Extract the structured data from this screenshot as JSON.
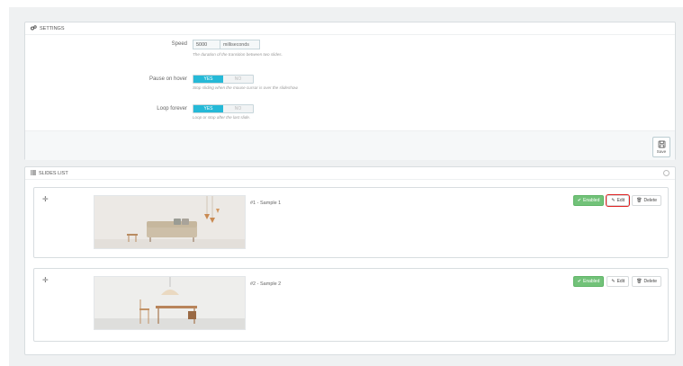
{
  "settings": {
    "heading": "SETTINGS",
    "speed": {
      "label": "Speed",
      "value": "5000",
      "unit": "milliseconds",
      "help": "The duration of the transition between two slides."
    },
    "pause_on_hover": {
      "label": "Pause on hover",
      "yes": "YES",
      "no": "NO",
      "selected": "YES",
      "help": "Stop sliding when the mouse cursor is over the slideshow."
    },
    "loop_forever": {
      "label": "Loop forever",
      "yes": "YES",
      "no": "NO",
      "selected": "YES",
      "help": "Loop or stop after the last slide."
    },
    "save_label": "Save"
  },
  "slides": {
    "heading": "SLIDES LIST",
    "items": [
      {
        "title": "#1 - Sample 1",
        "status_label": "Enabled",
        "edit_label": "Edit",
        "delete_label": "Delete"
      },
      {
        "title": "#2 - Sample 2",
        "status_label": "Enabled",
        "edit_label": "Edit",
        "delete_label": "Delete"
      }
    ]
  },
  "colors": {
    "accent": "#25b9d7",
    "enabled": "#72c279",
    "highlight": "#e02020",
    "background": "#eff1f2"
  },
  "icons": [
    "cogs-icon",
    "save-icon",
    "list-icon",
    "move-icon",
    "check-icon",
    "edit-icon",
    "trash-icon"
  ]
}
